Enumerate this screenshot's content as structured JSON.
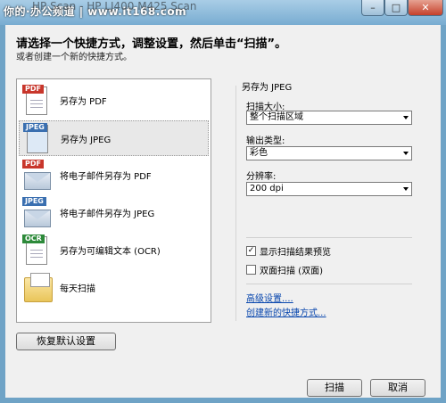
{
  "window": {
    "title": "HP Scan - HP LJ400 M425 Scan",
    "watermark": "你的·办公频道 | www.it168.com"
  },
  "instructions": {
    "main": "请选择一个快捷方式，调整设置，然后单击“扫描”。",
    "sub": "或者创建一个新的快捷方式。"
  },
  "shortcuts": [
    {
      "label": "另存为 PDF",
      "tag": "PDF",
      "icon": "pdf-document-icon"
    },
    {
      "label": "另存为 JPEG",
      "tag": "JPEG",
      "icon": "jpeg-document-icon"
    },
    {
      "label": "将电子邮件另存为 PDF",
      "tag": "PDF",
      "icon": "pdf-email-icon"
    },
    {
      "label": "将电子邮件另存为 JPEG",
      "tag": "JPEG",
      "icon": "jpeg-email-icon"
    },
    {
      "label": "另存为可编辑文本 (OCR)",
      "tag": "OCR",
      "icon": "ocr-document-icon"
    },
    {
      "label": "每天扫描",
      "tag": "",
      "icon": "folder-icon"
    }
  ],
  "settings": {
    "group_title": "另存为 JPEG",
    "scan_size_label": "扫描大小:",
    "scan_size_value": "整个扫描区域",
    "output_type_label": "输出类型:",
    "output_type_value": "彩色",
    "resolution_label": "分辨率:",
    "resolution_value": "200 dpi",
    "preview_label": "显示扫描结果预览",
    "duplex_label": "双面扫描 (双面)",
    "advanced_link": "高级设置....",
    "new_shortcut_link": "创建新的快捷方式..."
  },
  "buttons": {
    "restore": "恢复默认设置",
    "scan": "扫描",
    "cancel": "取消"
  },
  "colors": {
    "pdf_tag": "#c8362b",
    "jpeg_tag": "#3a6fb0",
    "ocr_tag": "#2d8a3a"
  }
}
